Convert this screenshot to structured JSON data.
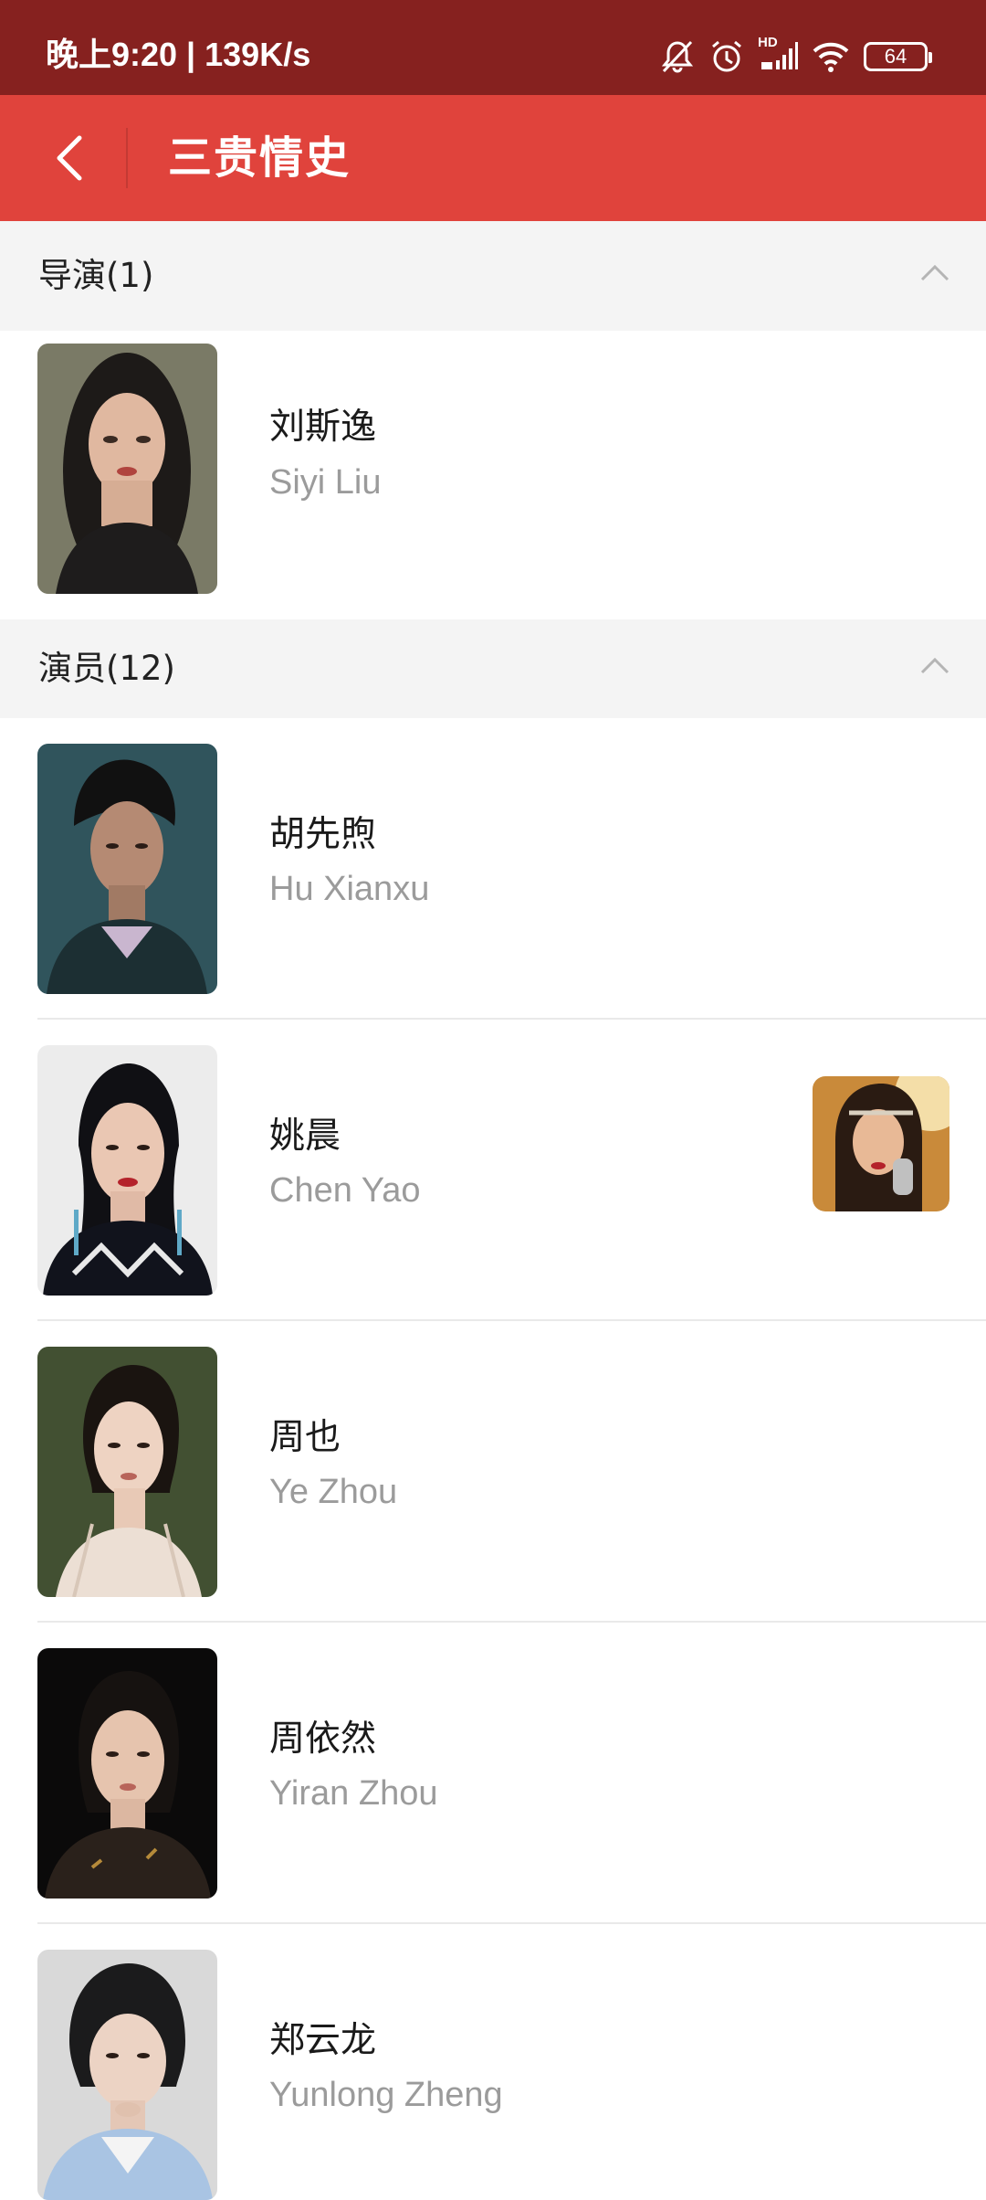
{
  "status_bar": {
    "time_speed": "晚上9:20 | 139K/s",
    "signal_label": "HD",
    "battery_level": "64"
  },
  "header": {
    "title": "三贵情史"
  },
  "sections": [
    {
      "title": "导演(1)",
      "people": [
        {
          "name_cn": "刘斯逸",
          "name_en": "Siyi Liu"
        }
      ]
    },
    {
      "title": "演员(12)",
      "people": [
        {
          "name_cn": "胡先煦",
          "name_en": "Hu Xianxu"
        },
        {
          "name_cn": "姚晨",
          "name_en": "Chen Yao"
        },
        {
          "name_cn": "周也",
          "name_en": "Ye Zhou"
        },
        {
          "name_cn": "周依然",
          "name_en": "Yiran Zhou"
        },
        {
          "name_cn": "郑云龙",
          "name_en": "Yunlong Zheng"
        }
      ]
    }
  ],
  "colors": {
    "status_bar": "#86211f",
    "app_bar": "#e0433c",
    "section_bg": "#f4f4f4",
    "secondary_text": "#9b9b9b"
  }
}
